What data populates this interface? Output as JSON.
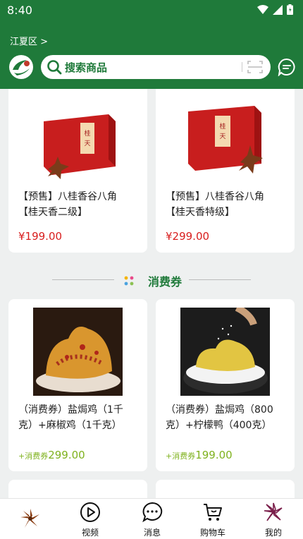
{
  "status": {
    "time": "8:40"
  },
  "header": {
    "location": "江夏区 >",
    "search_placeholder": "搜索商品"
  },
  "products_top": [
    {
      "title_line1": "【预售】八桂香谷八角",
      "title_line2": "【桂天香二级】",
      "price": "¥199.00"
    },
    {
      "title_line1": "【预售】八桂香谷八角",
      "title_line2": "【桂天香特级】",
      "price": "¥299.00"
    }
  ],
  "section": {
    "title": "消费券"
  },
  "coupons": [
    {
      "title_line1": "（消费券）盐焗鸡（1千",
      "title_line2": "克）+麻椒鸡（1千克）",
      "prefix": "+消费券",
      "price": "299.00"
    },
    {
      "title_line1": "（消费券）盐焗鸡（800",
      "title_line2": "克）+柠檬鸭（400克）",
      "prefix": "+消费券",
      "price": "199.00"
    }
  ],
  "nav": {
    "home_icon": "star-anise-icon",
    "items": [
      {
        "label": "视频",
        "icon": "play-icon"
      },
      {
        "label": "消息",
        "icon": "chat-icon"
      },
      {
        "label": "购物车",
        "icon": "cart-icon"
      },
      {
        "label": "我的",
        "icon": "flower-icon"
      }
    ]
  },
  "colors": {
    "brand_green": "#1f7a3a",
    "price_red": "#d81e1e",
    "coupon_green": "#7fb21e"
  }
}
